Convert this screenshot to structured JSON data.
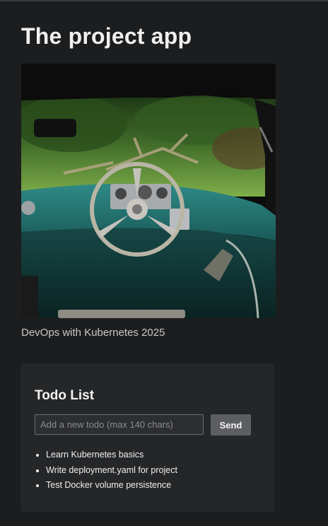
{
  "app": {
    "title": "The project app"
  },
  "image": {
    "caption": "DevOps with Kubernetes 2025",
    "alt": "Vintage teal car dashboard with steering wheel"
  },
  "todo": {
    "heading": "Todo List",
    "input_placeholder": "Add a new todo (max 140 chars)",
    "input_value": "",
    "send_label": "Send",
    "items": [
      "Learn Kubernetes basics",
      "Write deployment.yaml for project",
      "Test Docker volume persistence"
    ]
  },
  "colors": {
    "background": "#1c1d1f",
    "card": "#252628",
    "button": "#5d5e61"
  }
}
